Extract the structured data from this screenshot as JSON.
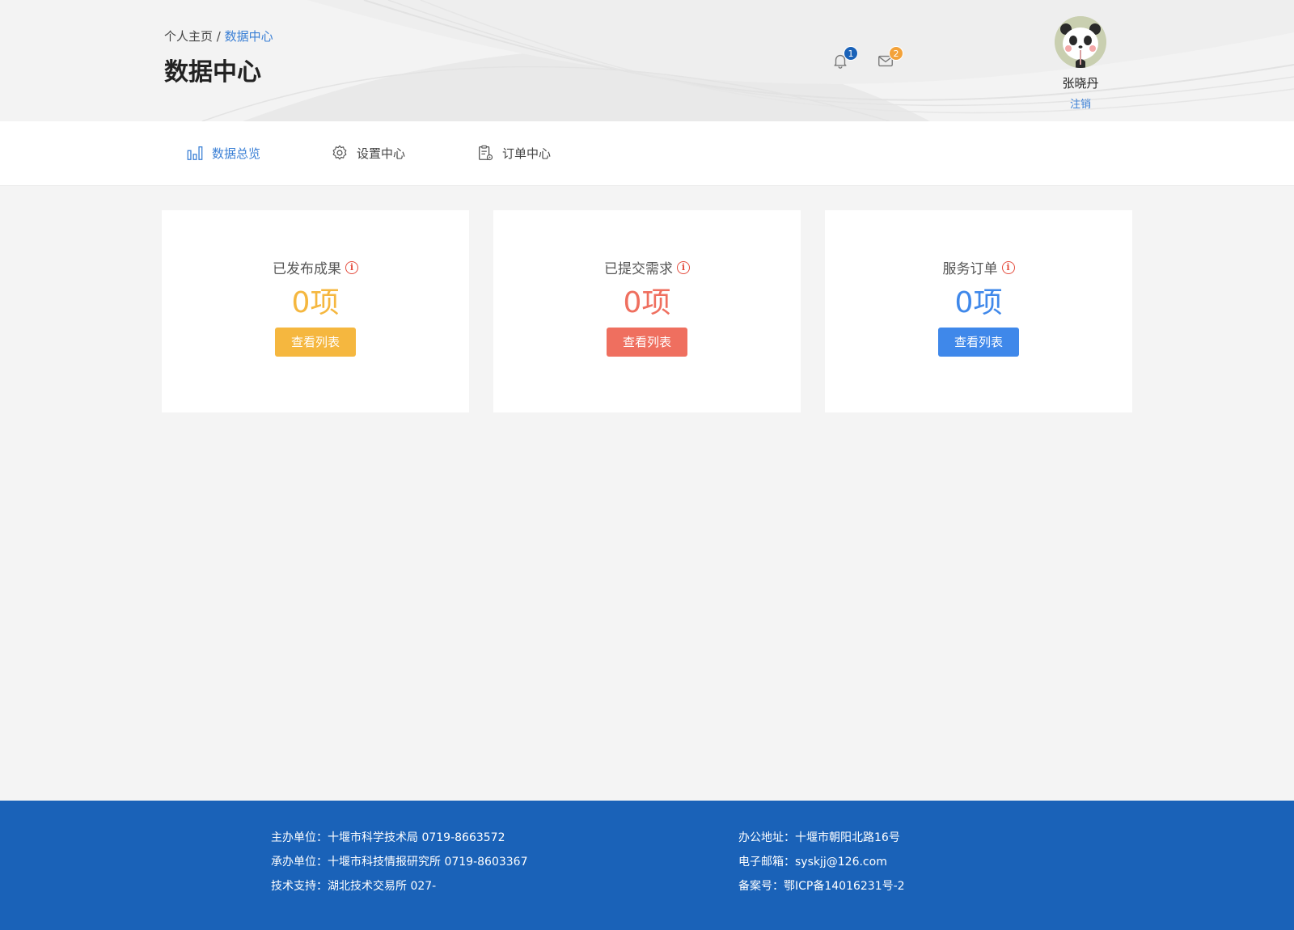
{
  "header": {
    "breadcrumb_home": "个人主页",
    "breadcrumb_sep": "/",
    "breadcrumb_current": "数据中心",
    "title": "数据中心",
    "notifications": {
      "icon": "bell-icon",
      "count": "1",
      "badge_color": "#1a62b8"
    },
    "messages": {
      "icon": "mail-icon",
      "count": "2",
      "badge_color": "#f3a23a"
    },
    "user": {
      "name": "张晓丹",
      "logout_label": "注销",
      "avatar_icon": "panda-avatar"
    }
  },
  "nav": {
    "items": [
      {
        "label": "数据总览",
        "icon": "bar-chart-icon",
        "active": true
      },
      {
        "label": "设置中心",
        "icon": "gear-icon",
        "active": false
      },
      {
        "label": "订单中心",
        "icon": "clipboard-icon",
        "active": false
      }
    ]
  },
  "cards": [
    {
      "label": "已发布成果",
      "value": "0项",
      "button": "查看列表",
      "color": "#f5b73f",
      "icon": "info-icon"
    },
    {
      "label": "已提交需求",
      "value": "0项",
      "button": "查看列表",
      "color": "#ef6f5f",
      "icon": "info-icon"
    },
    {
      "label": "服务订单",
      "value": "0项",
      "button": "查看列表",
      "color": "#3f88ea",
      "icon": "info-icon"
    }
  ],
  "footer": {
    "left": [
      "主办单位：十堰市科学技术局   0719-8663572",
      "承办单位：十堰市科技情报研究所   0719-8603367",
      "技术支持：湖北技术交易所   027-"
    ],
    "right": [
      "办公地址：十堰市朝阳北路16号",
      "电子邮箱：syskjj@126.com",
      "备案号：鄂ICP备14016231号-2"
    ]
  },
  "colors": {
    "accent": "#3a7fd5",
    "footer_bg": "#1a62b8",
    "page_bg": "#f4f4f4"
  }
}
